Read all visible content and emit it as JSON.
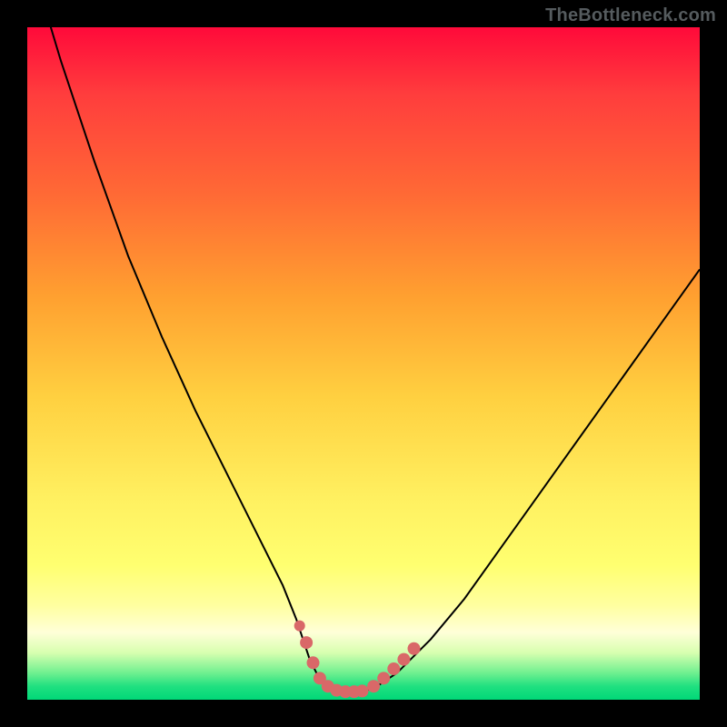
{
  "watermark": "TheBottleneck.com",
  "chart_data": {
    "type": "line",
    "title": "",
    "xlabel": "",
    "ylabel": "",
    "xlim": [
      0,
      100
    ],
    "ylim": [
      0,
      100
    ],
    "series": [
      {
        "name": "bottleneck-curve",
        "x": [
          0,
          2,
          5,
          10,
          15,
          20,
          25,
          30,
          35,
          38,
          40,
          41,
          42,
          43,
          44,
          45,
          46,
          47,
          48,
          49,
          50,
          52,
          55,
          60,
          65,
          70,
          75,
          80,
          85,
          90,
          95,
          100
        ],
        "y": [
          115,
          105,
          95,
          80,
          66,
          54,
          43,
          33,
          23,
          17,
          12,
          9,
          6,
          4,
          2.5,
          1.5,
          1,
          1,
          1,
          1,
          1.2,
          2,
          4,
          9,
          15,
          22,
          29,
          36,
          43,
          50,
          57,
          64
        ],
        "color": "#000000",
        "stroke_width": 2
      }
    ],
    "markers": [
      {
        "name": "left-dot-1",
        "x": 40.5,
        "y": 11,
        "r": 6,
        "color": "#d96868"
      },
      {
        "name": "left-dot-2",
        "x": 41.5,
        "y": 8.5,
        "r": 7,
        "color": "#d96868"
      },
      {
        "name": "left-dot-3",
        "x": 42.5,
        "y": 5.5,
        "r": 7,
        "color": "#d96868"
      },
      {
        "name": "bottom-dot-1",
        "x": 43.5,
        "y": 3.2,
        "r": 7,
        "color": "#d96868"
      },
      {
        "name": "bottom-dot-2",
        "x": 44.7,
        "y": 2.0,
        "r": 7,
        "color": "#d96868"
      },
      {
        "name": "bottom-dot-3",
        "x": 46.0,
        "y": 1.4,
        "r": 7,
        "color": "#d96868"
      },
      {
        "name": "bottom-dot-4",
        "x": 47.3,
        "y": 1.2,
        "r": 7,
        "color": "#d96868"
      },
      {
        "name": "bottom-dot-5",
        "x": 48.6,
        "y": 1.2,
        "r": 7,
        "color": "#d96868"
      },
      {
        "name": "bottom-dot-6",
        "x": 49.8,
        "y": 1.3,
        "r": 7,
        "color": "#d96868"
      },
      {
        "name": "right-dot-1",
        "x": 51.5,
        "y": 2.0,
        "r": 7,
        "color": "#d96868"
      },
      {
        "name": "right-dot-2",
        "x": 53.0,
        "y": 3.2,
        "r": 7,
        "color": "#d96868"
      },
      {
        "name": "right-dot-3",
        "x": 54.5,
        "y": 4.6,
        "r": 7,
        "color": "#d96868"
      },
      {
        "name": "right-dot-4",
        "x": 56.0,
        "y": 6.0,
        "r": 7,
        "color": "#d96868"
      },
      {
        "name": "right-dot-5",
        "x": 57.5,
        "y": 7.6,
        "r": 7,
        "color": "#d96868"
      }
    ]
  }
}
